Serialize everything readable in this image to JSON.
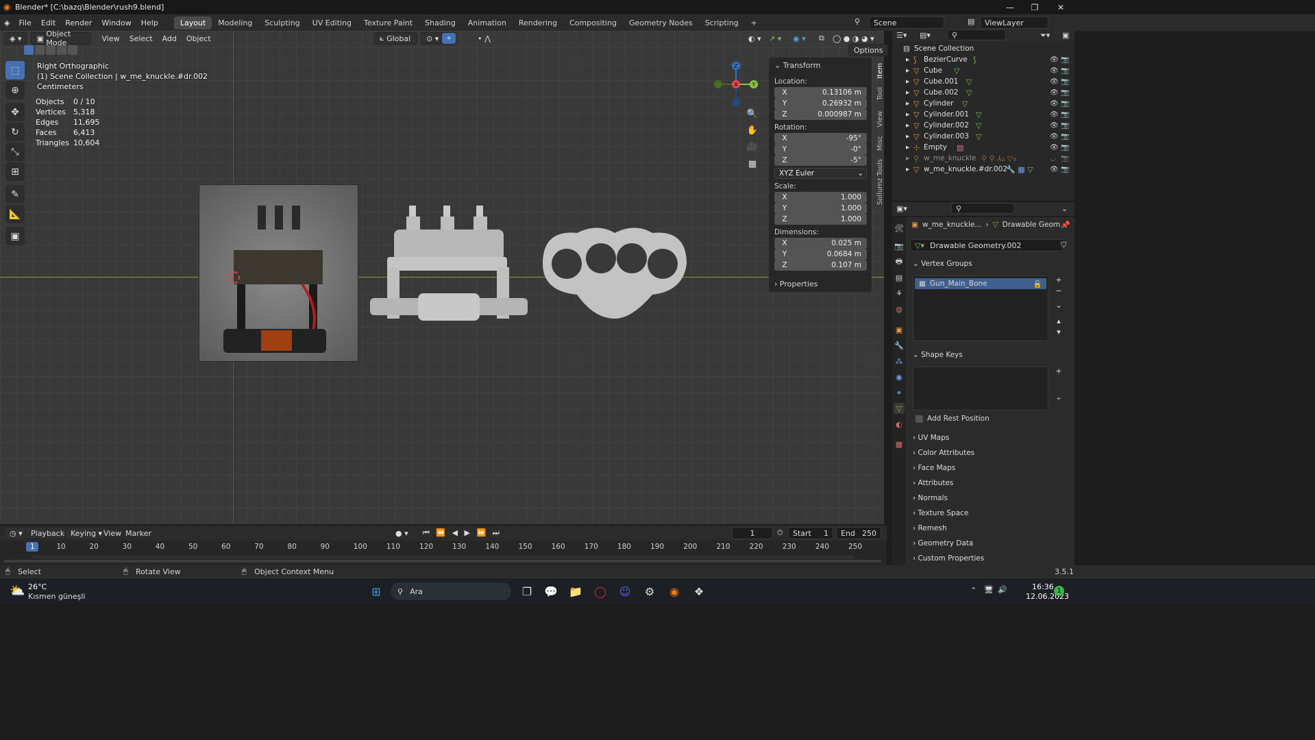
{
  "window": {
    "title": "Blender* [C:\\bazq\\Blender\\rush9.blend]"
  },
  "menubar": {
    "items": [
      "File",
      "Edit",
      "Render",
      "Window",
      "Help"
    ],
    "workspaces": [
      "Layout",
      "Modeling",
      "Sculpting",
      "UV Editing",
      "Texture Paint",
      "Shading",
      "Animation",
      "Rendering",
      "Compositing",
      "Geometry Nodes",
      "Scripting"
    ],
    "scene": "Scene",
    "viewlayer": "ViewLayer"
  },
  "viewport_header": {
    "mode": "Object Mode",
    "menus": [
      "View",
      "Select",
      "Add",
      "Object"
    ],
    "orientation": "Global",
    "options": "Options"
  },
  "viewport": {
    "view_name": "Right Orthographic",
    "collection_line": "(1) Scene Collection | w_me_knuckle.#dr.002",
    "units": "Centimeters",
    "stats": [
      {
        "label": "Objects",
        "value": "0 / 10"
      },
      {
        "label": "Vertices",
        "value": "5,318"
      },
      {
        "label": "Edges",
        "value": "11,695"
      },
      {
        "label": "Faces",
        "value": "6,413"
      },
      {
        "label": "Triangles",
        "value": "10,604"
      }
    ],
    "gizmo": {
      "z": "Z",
      "x": "X",
      "y": "Y"
    }
  },
  "npanel": {
    "title": "Transform",
    "location_label": "Location:",
    "location": [
      {
        "axis": "X",
        "value": "0.13106 m"
      },
      {
        "axis": "Y",
        "value": "0.26932 m"
      },
      {
        "axis": "Z",
        "value": "0.000987 m"
      }
    ],
    "rotation_label": "Rotation:",
    "rotation": [
      {
        "axis": "X",
        "value": "-95°"
      },
      {
        "axis": "Y",
        "value": "-0°"
      },
      {
        "axis": "Z",
        "value": "-5°"
      }
    ],
    "rotation_mode": "XYZ Euler",
    "scale_label": "Scale:",
    "scale": [
      {
        "axis": "X",
        "value": "1.000"
      },
      {
        "axis": "Y",
        "value": "1.000"
      },
      {
        "axis": "Z",
        "value": "1.000"
      }
    ],
    "dimensions_label": "Dimensions:",
    "dimensions": [
      {
        "axis": "X",
        "value": "0.025 m"
      },
      {
        "axis": "Y",
        "value": "0.0684 m"
      },
      {
        "axis": "Z",
        "value": "0.107 m"
      }
    ],
    "properties": "Properties",
    "tabs": [
      "Item",
      "Tool",
      "View",
      "Misc",
      "Sollumz Tools"
    ]
  },
  "outliner": {
    "root": "Scene Collection",
    "items": [
      "BezierCurve",
      "Cube",
      "Cube.001",
      "Cube.002",
      "Cylinder",
      "Cylinder.001",
      "Cylinder.002",
      "Cylinder.003",
      "Empty",
      "w_me_knuckle",
      "w_me_knuckle.#dr.002"
    ]
  },
  "properties": {
    "breadcrumb_object": "w_me_knuckle...",
    "breadcrumb_data": "Drawable Geom...",
    "datablock": "Drawable Geometry.002",
    "vertex_groups": "Vertex Groups",
    "vertex_group_item": "Gun_Main_Bone",
    "shape_keys": "Shape Keys",
    "add_rest_position": "Add Rest Position",
    "sections": [
      "UV Maps",
      "Color Attributes",
      "Face Maps",
      "Attributes",
      "Normals",
      "Texture Space",
      "Remesh",
      "Geometry Data",
      "Custom Properties"
    ]
  },
  "timeline": {
    "menus": [
      "Playback",
      "Keying",
      "View",
      "Marker"
    ],
    "current_frame": "1",
    "start_label": "Start",
    "start": "1",
    "end_label": "End",
    "end": "250",
    "ruler": [
      "1",
      "10",
      "20",
      "30",
      "40",
      "50",
      "60",
      "70",
      "80",
      "90",
      "100",
      "110",
      "120",
      "130",
      "140",
      "150",
      "160",
      "170",
      "180",
      "190",
      "200",
      "210",
      "220",
      "230",
      "240",
      "250"
    ]
  },
  "statusbar": {
    "select": "Select",
    "rotate": "Rotate View",
    "context": "Object Context Menu",
    "version": "3.5.1"
  },
  "taskbar": {
    "weather_temp": "26°C",
    "weather_desc": "Kısmen güneşli",
    "search": "Ara",
    "time": "16:36",
    "date": "12.06.2023",
    "notif": "1"
  },
  "colors": {
    "accent": "#4672b4",
    "viewport": "#393939",
    "x_axis": "#e5474f",
    "y_axis": "#8bc53f",
    "z_axis": "#2f76c5"
  }
}
